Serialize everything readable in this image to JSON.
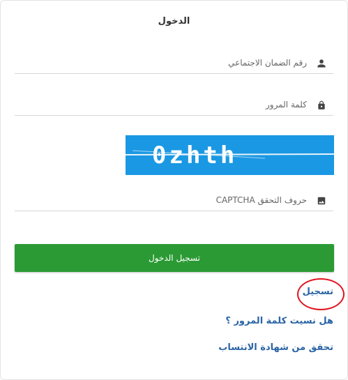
{
  "form": {
    "title": "الدخول",
    "ssn_placeholder": "رقم الضمان الاجتماعي",
    "password_placeholder": "كلمة المرور",
    "captcha_text": "0zhth",
    "captcha_placeholder": "حروف التحقق CAPTCHA",
    "login_button": "تسجيل الدخول"
  },
  "links": {
    "register": "تسجيل",
    "forgot_password": "هل نسيت كلمة المرور ؟",
    "verify_certificate": "تحقق من شهادة الانتساب"
  },
  "icons": {
    "ssn": "person-icon",
    "password": "lock-icon",
    "captcha": "image-icon"
  },
  "colors": {
    "login_button": "#2b9a34",
    "links": "#2a64a5",
    "captcha_bg": "#1b98e3",
    "highlight_ring": "#e0141e"
  }
}
